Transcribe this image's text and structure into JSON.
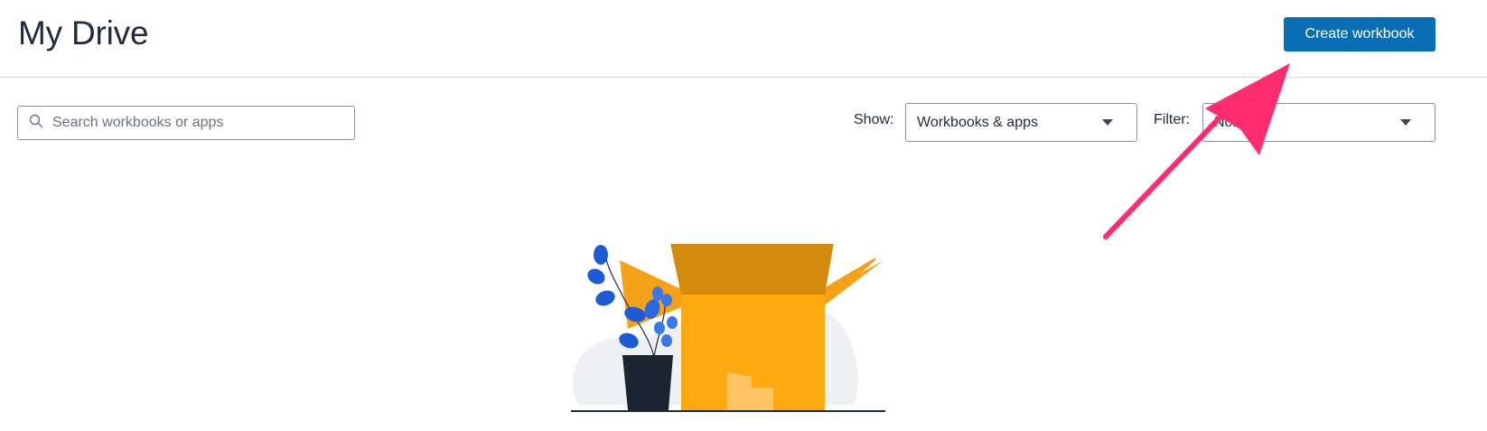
{
  "header": {
    "title": "My Drive",
    "create_label": "Create workbook"
  },
  "search": {
    "placeholder": "Search workbooks or apps",
    "value": ""
  },
  "show": {
    "label": "Show:",
    "selected": "Workbooks & apps"
  },
  "filter": {
    "label": "Filter:",
    "selected": "None"
  },
  "icons": {
    "search": "search-icon",
    "dropdown": "caret-down-icon",
    "empty_state": "empty-box-illustration",
    "annotation": "pointer-arrow"
  },
  "colors": {
    "primary_button": "#0a6eb4",
    "annotation_arrow": "#ff2d6f",
    "box_main": "#fda90f",
    "box_lid": "#d48a0c",
    "plant": "#2563eb"
  }
}
